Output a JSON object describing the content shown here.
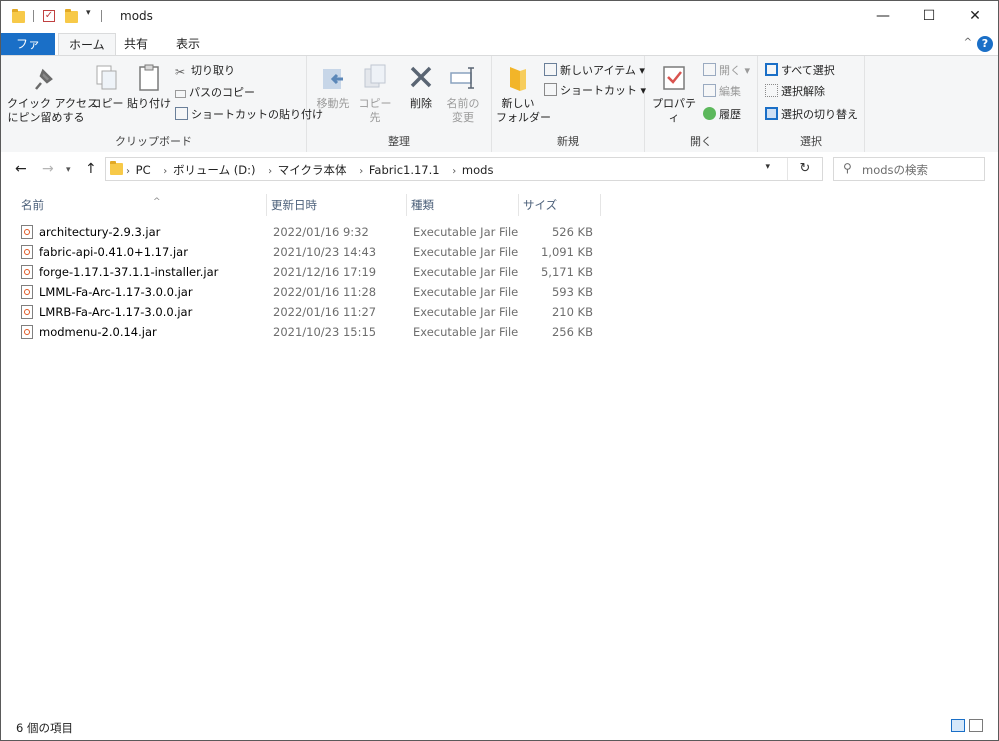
{
  "titlebar": {
    "title": "mods",
    "minimize_glyph": "—",
    "maximize_glyph": "☐",
    "close_glyph": "✕"
  },
  "tabs": [
    {
      "label": "ファイル"
    },
    {
      "label": "ホーム"
    },
    {
      "label": "共有"
    },
    {
      "label": "表示"
    }
  ],
  "ribbon": {
    "clipboard": {
      "label": "クリップボード",
      "pin": "クイック アクセス\nにピン留めする",
      "copy": "コピー",
      "paste": "貼り付け",
      "cut": "切り取り",
      "copy_path": "パスのコピー",
      "paste_shortcut": "ショートカットの貼り付け"
    },
    "organize": {
      "label": "整理",
      "move_to": "移動先",
      "copy_to": "コピー先",
      "delete": "削除",
      "rename": "名前の\n変更"
    },
    "new": {
      "label": "新規",
      "new_folder": "新しい\nフォルダー",
      "new_item": "新しいアイテム",
      "easy_access": "ショートカット"
    },
    "open": {
      "label": "開く",
      "properties": "プロパティ",
      "open": "開く",
      "edit": "編集",
      "history": "履歴"
    },
    "select": {
      "label": "選択",
      "select_all": "すべて選択",
      "select_none": "選択解除",
      "invert": "選択の切り替え"
    }
  },
  "address": {
    "crumbs": [
      "PC",
      "ボリューム (D:)",
      "マイクラ本体",
      "Fabric1.17.1",
      "mods"
    ],
    "search_placeholder": "modsの検索"
  },
  "columns": {
    "name": "名前",
    "date": "更新日時",
    "type": "種類",
    "size": "サイズ"
  },
  "files": [
    {
      "name": "architectury-2.9.3.jar",
      "date": "2022/01/16 9:32",
      "type": "Executable Jar File",
      "size": "526 KB"
    },
    {
      "name": "fabric-api-0.41.0+1.17.jar",
      "date": "2021/10/23 14:43",
      "type": "Executable Jar File",
      "size": "1,091 KB"
    },
    {
      "name": "forge-1.17.1-37.1.1-installer.jar",
      "date": "2021/12/16 17:19",
      "type": "Executable Jar File",
      "size": "5,171 KB"
    },
    {
      "name": "LMML-Fa-Arc-1.17-3.0.0.jar",
      "date": "2022/01/16 11:28",
      "type": "Executable Jar File",
      "size": "593 KB"
    },
    {
      "name": "LMRB-Fa-Arc-1.17-3.0.0.jar",
      "date": "2022/01/16 11:27",
      "type": "Executable Jar File",
      "size": "210 KB"
    },
    {
      "name": "modmenu-2.0.14.jar",
      "date": "2021/10/23 15:15",
      "type": "Executable Jar File",
      "size": "256 KB"
    }
  ],
  "status": {
    "item_count": "6 個の項目"
  },
  "colors": {
    "accent": "#1a6fc7",
    "ribbon_bg": "#f5f6f7",
    "header_text": "#4c607a"
  }
}
